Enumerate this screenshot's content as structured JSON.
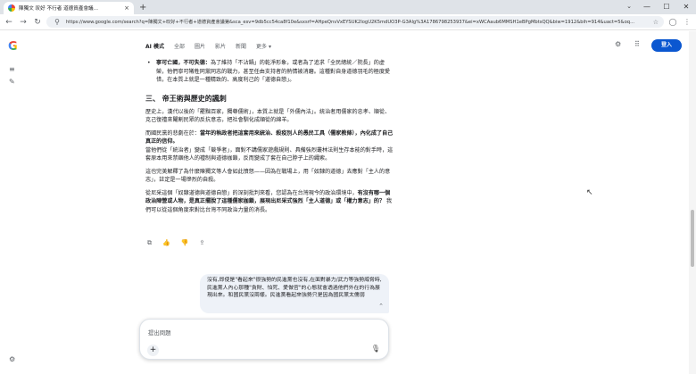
{
  "browser": {
    "tab_title": "陳獨文 叹好 不行者 道德資產會議...",
    "tab_close": "×",
    "new_tab": "+",
    "url": "https://www.google.com/search?q=陳獨文+叹好+不行者+道德資產會議第&sca_esv=9db5cc54ca8f10e&sxsrf=AHpeQnvVxEYSUK2IogU2K5mdUO3P-G3Alg%3A1786798253937&ei=xWCAaub6MMSH1eBPgMbtsQQ&biw=1912&bih=914&uact=5&oq..."
  },
  "header": {
    "modes": [
      "AI 模式",
      "全部",
      "圖片",
      "影片",
      "新聞",
      "更多 ▾"
    ],
    "login_label": "登入"
  },
  "content": {
    "bullet_lead": "寧可亡國，不可失德：",
    "bullet_text": "為了維持「不沾鍋」的乾淨形象，或者為了追求「全民總統／院長」的虛榮，他們寧可犧牲同黨同志的戰力，甚至任由支持者的熱情被消磨。這種對自身道德羽毛的極度愛惜，在本質上就是一種精致的、高度利己的「道德自戀」。",
    "section_title": "三、 帝王術與歷史的諷刺",
    "p1": "歷史上，漢代以後的「罷黜百家，獨尊儒術」，本質上就是「外儒內法」。統治者用儒家的忠孝、順從、克己復禮來閹割民眾的反抗意志，把社會馴化成順從的綿羊。",
    "p2_lead": "而國民黨的悲劇在於：",
    "p2_bold": "當年的執政者把這套用來統治、殺疫別人的愚民工具（儒家教條），內化成了自己真正的信仰。",
    "p2_rest": "當他們從「統治者」變成「競爭者」，面對不講儒家遊戲規則、具備強烈叢林法則生存本能的對手時，這套原本用來禁錮他人的禮制與道德枷鎖，反而變成了套在自己脖子上的繩索。",
    "p3": "這也完美解釋了為什麼陳獨文等人會如此憤怒——因為在戰場上，用「奴隸的道德」去應對「主人的意志」，註定是一場慘烈的自殺。",
    "p4_a": "從尼采這個「奴隸道德與道德自戀」的深刻批判來看，您認為在台灣現今的政治環境中，",
    "p4_bold": "有沒有哪一個政治陣營或人物，是真正擺脫了這種儒家枷鎖，展現出尼采式強烈「主人道德」或「權力意志」的？",
    "p4_b": " 我們可以從這個角度來對比台灣不同政治力量的消長。"
  },
  "bubble": {
    "text": "沒有,即使是\"看起來\"很強勢的民進黨也沒有,在面對暴力/武力等強勢威脅時,民進黨人內心那種\"貪財、怕死、愛做官\"的心態就會透過他們外在的行為展現出來。和國民黨沒兩樣。民進黨看起來強勢只是因為國民黨太儒弱"
  },
  "composer": {
    "placeholder": "提出問題"
  }
}
